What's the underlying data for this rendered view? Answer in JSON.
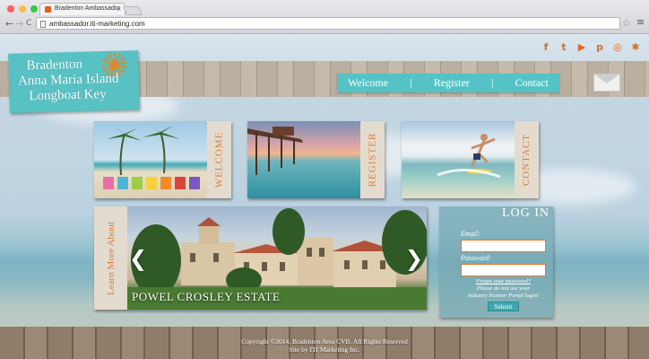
{
  "browser": {
    "tab_title": "Bradenton Ambassador",
    "tab_close": "×",
    "url": "ambassador.iti-marketing.com",
    "back": "←",
    "forward": "→",
    "reload": "C",
    "bookmark": "☆",
    "menu": "≡",
    "traffic_colors": [
      "#fc605c",
      "#fdbc40",
      "#34c84a"
    ]
  },
  "social": {
    "icons": [
      "facebook-icon",
      "twitter-icon",
      "youtube-icon",
      "pinterest-icon",
      "tripadvisor-icon",
      "yelp-icon"
    ],
    "glyphs": [
      "f",
      "t",
      "▶",
      "p",
      "◎",
      "✱"
    ],
    "color": "#e06a1f"
  },
  "logo": {
    "line1": "Bradenton",
    "line2": "Anna Maria Island",
    "line3": "Longboat Key"
  },
  "nav": {
    "welcome": "Welcome",
    "sep1": "|",
    "register": "Register",
    "sep2": "|",
    "contact": "Contact"
  },
  "tiles": {
    "welcome": "WELCOME",
    "register": "REGISTER",
    "contact": "CONTACT"
  },
  "learn": {
    "label": "Learn More About",
    "prev": "❮",
    "next": "❯",
    "caption": "POWEL CROSLEY ESTATE"
  },
  "login": {
    "title": "LOG IN",
    "email_label": "Email:",
    "password_label": "Password:",
    "forgot": "Forgot your password?",
    "note1": "Please do not use your",
    "note2": "Industry Partner Portal login!",
    "submit": "Submit"
  },
  "footer": {
    "copyright": "Copyright ©2014, Bradenton Area CVB. All Rights Reserved",
    "credit": "Site by ITI Marketing Inc."
  },
  "colors": {
    "accent_teal": "#55c3c6",
    "accent_orange": "#e07a2e"
  }
}
